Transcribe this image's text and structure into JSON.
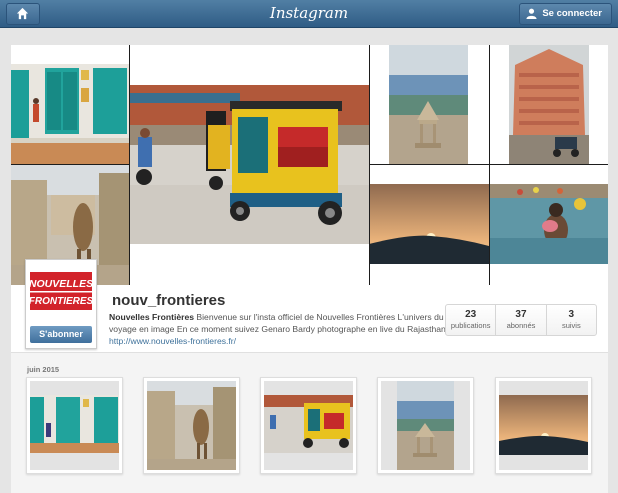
{
  "topbar": {
    "brand": "Instagram",
    "login_label": "Se connecter"
  },
  "profile": {
    "logo_line1": "NOUVELLES",
    "logo_line2": "FRONTIERES",
    "subscribe_label": "S'abonner",
    "username": "nouv_frontieres",
    "bio_name": "Nouvelles Frontières",
    "bio_text": "Bienvenue sur l'insta officiel de Nouvelles Frontières L'univers du voyage en image En ce moment suivez Genaro Bardy photographe en live du Rajasthan",
    "bio_link": "http://www.nouvelles-frontieres.fr/",
    "stats": [
      {
        "num": "23",
        "label": "publications"
      },
      {
        "num": "37",
        "label": "abonnés"
      },
      {
        "num": "3",
        "label": "suivis"
      }
    ]
  },
  "feed": {
    "month": "juin 2015"
  },
  "colors": {
    "topbar": "#3b6a92",
    "logo_red": "#d2232a",
    "link": "#3f729b"
  }
}
